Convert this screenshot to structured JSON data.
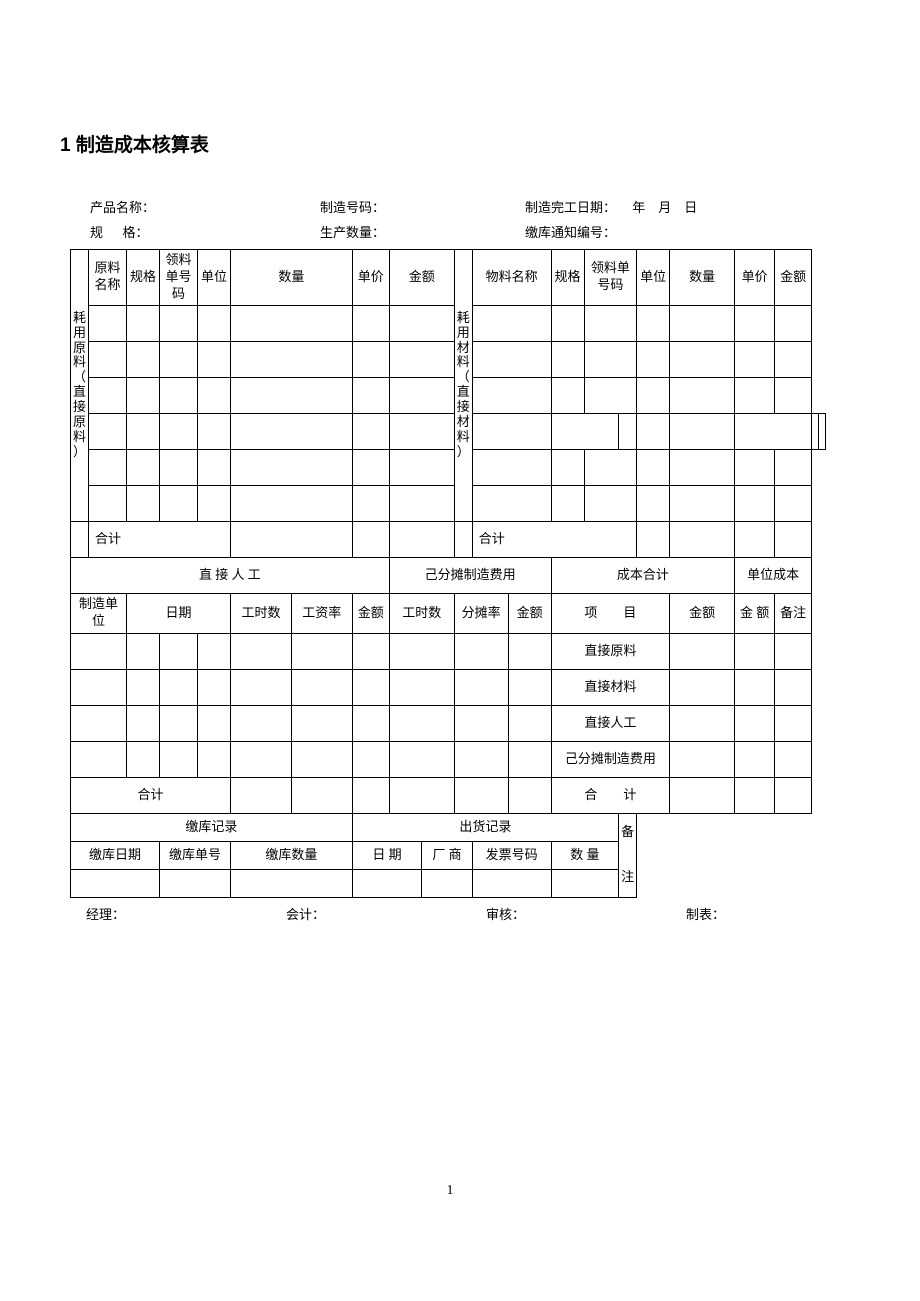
{
  "title": "1 制造成本核算表",
  "meta": {
    "product_name_label": "产品名称：",
    "spec_label_part1": "规",
    "spec_label_part2": "格：",
    "mfg_no_label": "制造号码：",
    "qty_label": "生产数量：",
    "complete_date_label": "制造完工日期：",
    "date_year": "年",
    "date_month": "月",
    "date_day": "日",
    "warehouse_notice_label": "缴库通知编号："
  },
  "left_vert": "耗用原料（直接原料）",
  "right_vert": "耗用材料（直接材料）",
  "cols": {
    "raw_name": "原料名称",
    "spec": "规格",
    "req_no": "领料单号码",
    "unit": "单位",
    "qty": "数量",
    "price": "单价",
    "amount": "金额",
    "mat_name": "物料名称"
  },
  "subtotal": "合计",
  "section2": {
    "direct_labor": "直 接 人 工",
    "allocated": "己分摊制造费用",
    "cost_total": "成本合计",
    "unit_cost": "单位成本",
    "mfg_unit": "制造单位",
    "date": "日期",
    "hours": "工时数",
    "wage_rate": "工资率",
    "amount": "金额",
    "alloc_rate": "分摊率",
    "item": "项　　目",
    "amt2": "金额",
    "amt3": "金 额",
    "remark": "备注"
  },
  "items": {
    "direct_raw": "直接原料",
    "direct_mat": "直接材料",
    "direct_labor": "直接人工",
    "alloc_mfg": "己分摊制造费用",
    "total": "合　　计"
  },
  "section3": {
    "in_record": "缴库记录",
    "out_record": "出货记录",
    "in_date": "缴库日期",
    "in_no": "缴库单号",
    "in_qty": "缴库数量",
    "date": "日  期",
    "vendor": "厂  商",
    "inv_no": "发票号码",
    "qty": "数  量",
    "remark_v1": "备",
    "remark_v2": "注"
  },
  "sig": {
    "manager": "经理：",
    "acct": "会计：",
    "audit": "审核：",
    "maker": "制表："
  },
  "page_num": "1"
}
